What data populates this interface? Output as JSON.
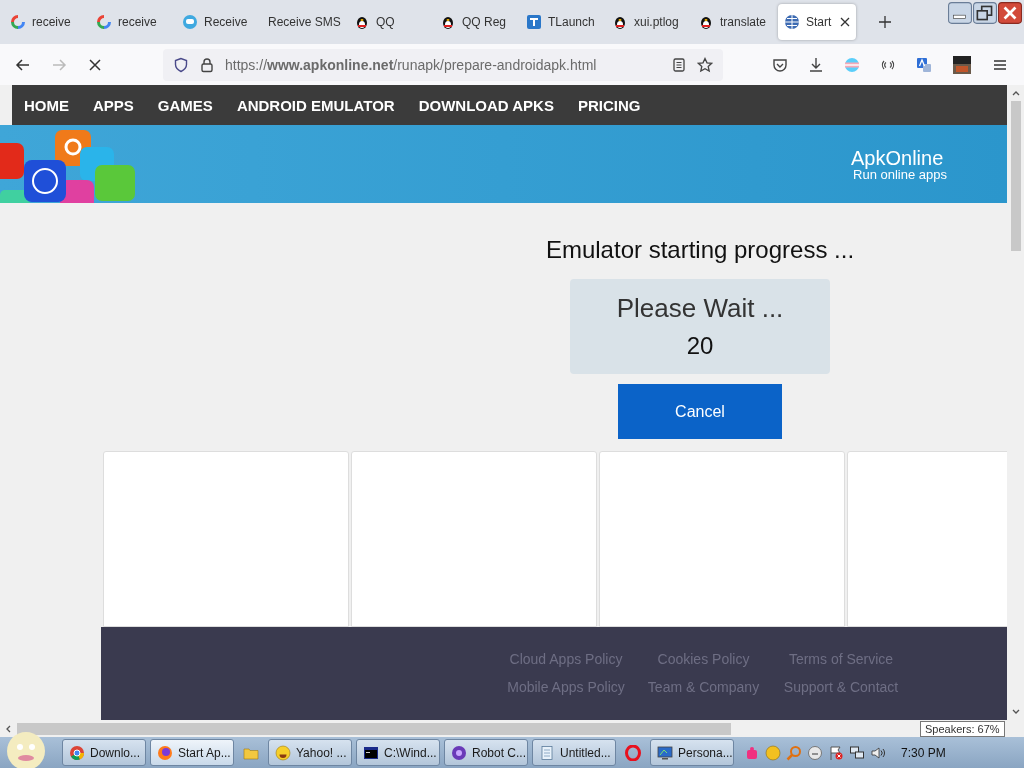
{
  "browser_tabs": [
    {
      "kind": "google",
      "title": "receive",
      "selected": false
    },
    {
      "kind": "google",
      "title": "receive",
      "selected": false
    },
    {
      "kind": "bubble",
      "title": "Receive",
      "selected": false
    },
    {
      "kind": "none",
      "title": "Receive SMS",
      "selected": false
    },
    {
      "kind": "penguin",
      "title": "QQ",
      "selected": false
    },
    {
      "kind": "penguin",
      "title": "QQ Reg",
      "selected": false
    },
    {
      "kind": "tl",
      "title": "TLaunch",
      "selected": false
    },
    {
      "kind": "penguin",
      "title": "xui.ptlog",
      "selected": false
    },
    {
      "kind": "penguin",
      "title": "translate",
      "selected": false
    },
    {
      "kind": "globe",
      "title": "Start",
      "selected": true
    }
  ],
  "toolbar": {
    "url": "https://**www.apkonline.net**/runapk/prepare-androidapk.html",
    "loading": true,
    "forward_disabled": true
  },
  "nav": [
    "HOME",
    "APPS",
    "GAMES",
    "ANDROID EMULATOR",
    "DOWNLOAD APKS",
    "PRICING"
  ],
  "banner": {
    "brand": "ApkOnline",
    "tagline": "Run online apps"
  },
  "progress": {
    "heading": "Emulator starting progress ...",
    "wait_text": "Please Wait ...",
    "countdown": "20",
    "cancel": "Cancel"
  },
  "app_cards": [
    {
      "kind": "card"
    },
    {
      "kind": "card"
    },
    {
      "kind": "card"
    },
    {
      "kind": "card"
    }
  ],
  "footer_links": [
    "Cloud Apps Policy",
    "Cookies Policy",
    "Terms of Service",
    "Mobile Apps Policy",
    "Team & Company",
    "Support & Contact"
  ],
  "taskbar": {
    "buttons": [
      {
        "kind": "chrome",
        "label": "Downlo...",
        "selected": false
      },
      {
        "kind": "firefox",
        "label": "Start Ap...",
        "selected": true
      },
      {
        "kind": "folder",
        "selected": false
      },
      {
        "kind": "smiley",
        "label": "Yahoo! ...",
        "selected": false
      },
      {
        "kind": "cmd",
        "label": "C:\\Wind...",
        "selected": false
      },
      {
        "kind": "robot",
        "label": "Robot C...",
        "selected": false
      },
      {
        "kind": "notepad",
        "label": "Untitled...",
        "selected": false
      },
      {
        "kind": "opera",
        "selected": false
      },
      {
        "kind": "monitor",
        "label": "Persona...",
        "selected": false
      }
    ],
    "clock": "7:30 PM",
    "tooltip": "Speakers: 67%"
  }
}
